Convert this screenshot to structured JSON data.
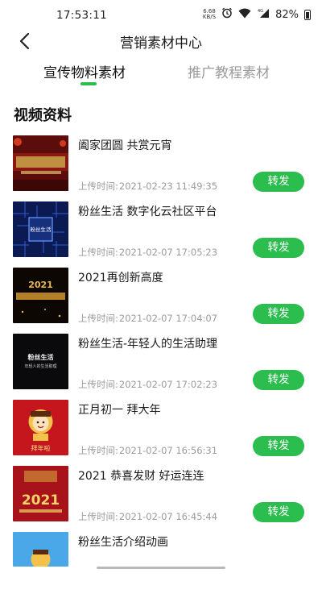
{
  "status_bar": {
    "time": "17:53:11",
    "net_speed_value": "6.68",
    "net_speed_unit": "KB/S",
    "signal": "4G",
    "battery": "82%"
  },
  "header": {
    "title": "营销素材中心",
    "back_icon": "chevron-left-icon"
  },
  "tabs": [
    {
      "label": "宣传物料素材",
      "active": true
    },
    {
      "label": "推广教程素材",
      "active": false
    }
  ],
  "section": {
    "title": "视频资料"
  },
  "upload_prefix": "上传时间:",
  "share_label": "转发",
  "accent_color": "#2bbd4e",
  "videos": [
    {
      "title": "阖家团圆 共赏元宵",
      "time": "2021-02-23 11:49:35"
    },
    {
      "title": "粉丝生活 数字化云社区平台",
      "time": "2021-02-07 17:05:23"
    },
    {
      "title": "2021再创新高度",
      "time": "2021-02-07 17:04:07"
    },
    {
      "title": "粉丝生活-年轻人的生活助理",
      "time": "2021-02-07 17:02:23"
    },
    {
      "title": "正月初一  拜大年",
      "time": "2021-02-07 16:56:31"
    },
    {
      "title": "2021 恭喜发财 好运连连",
      "time": "2021-02-07 16:45:44"
    },
    {
      "title": "粉丝生活介绍动画",
      "time": ""
    }
  ],
  "thumb_text": {
    "t2": "粉丝生活",
    "t3_year": "2021",
    "t4_main": "粉丝生活",
    "t4_sub": "年轻人的生活助理",
    "t5": "拜年啦",
    "t6_year": "2021"
  }
}
